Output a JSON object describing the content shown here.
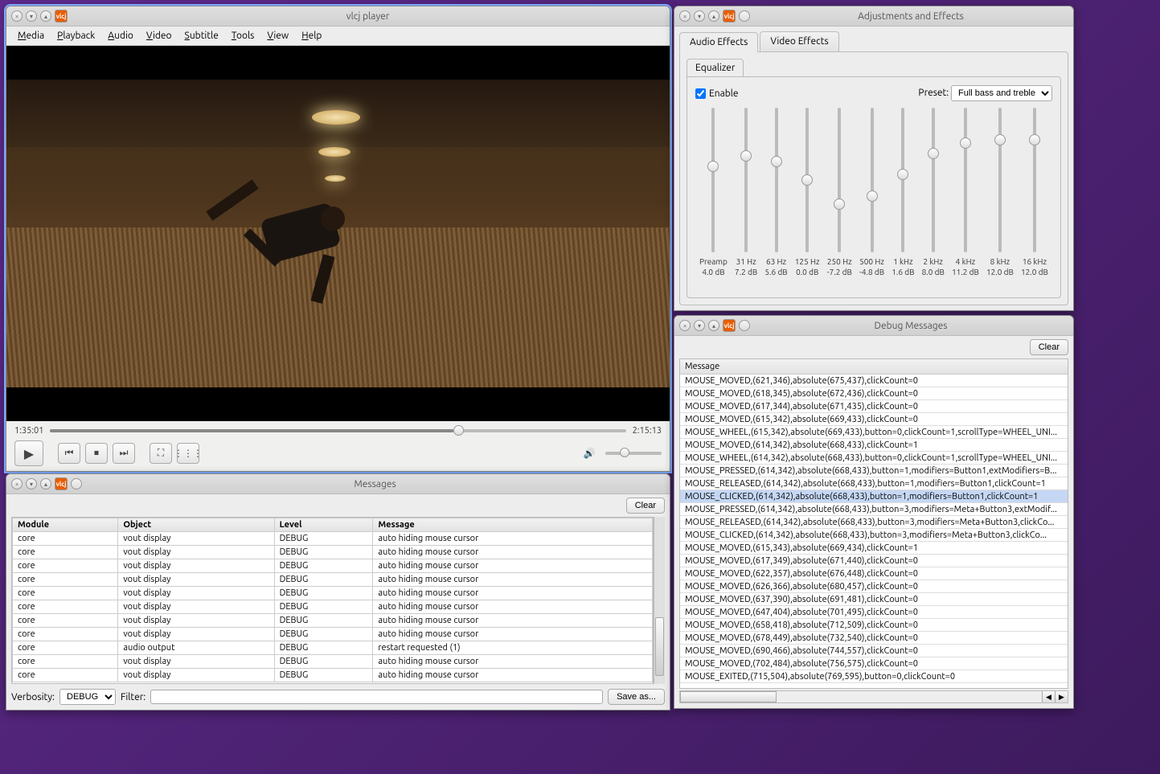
{
  "player": {
    "title": "vlcj player",
    "menu": [
      "Media",
      "Playback",
      "Audio",
      "Video",
      "Subtitle",
      "Tools",
      "View",
      "Help"
    ],
    "time_current": "1:35:01",
    "time_total": "2:15:13",
    "progress_pct": 70,
    "volume_pct": 25,
    "buttons": {
      "play": "▶",
      "prev": "⏮",
      "stop": "⏹",
      "next": "⏭",
      "fullscreen": "⛶",
      "ext": "⋮⋮⋮",
      "speaker": "🔊"
    }
  },
  "messages": {
    "title": "Messages",
    "clear_btn": "Clear",
    "cols": [
      "Module",
      "Object",
      "Level",
      "Message"
    ],
    "rows": [
      [
        "core",
        "vout display",
        "DEBUG",
        "auto hiding mouse cursor"
      ],
      [
        "core",
        "vout display",
        "DEBUG",
        "auto hiding mouse cursor"
      ],
      [
        "core",
        "vout display",
        "DEBUG",
        "auto hiding mouse cursor"
      ],
      [
        "core",
        "vout display",
        "DEBUG",
        "auto hiding mouse cursor"
      ],
      [
        "core",
        "vout display",
        "DEBUG",
        "auto hiding mouse cursor"
      ],
      [
        "core",
        "vout display",
        "DEBUG",
        "auto hiding mouse cursor"
      ],
      [
        "core",
        "vout display",
        "DEBUG",
        "auto hiding mouse cursor"
      ],
      [
        "core",
        "vout display",
        "DEBUG",
        "auto hiding mouse cursor"
      ],
      [
        "core",
        "audio output",
        "DEBUG",
        "restart requested (1)"
      ],
      [
        "core",
        "vout display",
        "DEBUG",
        "auto hiding mouse cursor"
      ],
      [
        "core",
        "vout display",
        "DEBUG",
        "auto hiding mouse cursor"
      ]
    ],
    "verbosity_label": "Verbosity:",
    "verbosity_value": "DEBUG",
    "filter_label": "Filter:",
    "save_btn": "Save as..."
  },
  "adjust": {
    "title": "Adjustments and Effects",
    "tabs": [
      "Audio Effects",
      "Video Effects"
    ],
    "eq_tab": "Equalizer",
    "enable_label": "Enable",
    "preset_label": "Preset:",
    "preset_value": "Full bass and treble",
    "bands": [
      {
        "label": "Preamp",
        "db": "4.0 dB",
        "pct": 60
      },
      {
        "label": "31 Hz",
        "db": "7.2 dB",
        "pct": 68
      },
      {
        "label": "63 Hz",
        "db": "5.6 dB",
        "pct": 64
      },
      {
        "label": "125 Hz",
        "db": "0.0 dB",
        "pct": 50
      },
      {
        "label": "250 Hz",
        "db": "-7.2 dB",
        "pct": 32
      },
      {
        "label": "500 Hz",
        "db": "-4.8 dB",
        "pct": 38
      },
      {
        "label": "1 kHz",
        "db": "1.6 dB",
        "pct": 54
      },
      {
        "label": "2 kHz",
        "db": "8.0 dB",
        "pct": 70
      },
      {
        "label": "4 kHz",
        "db": "11.2 dB",
        "pct": 78
      },
      {
        "label": "8 kHz",
        "db": "12.0 dB",
        "pct": 80
      },
      {
        "label": "16 kHz",
        "db": "12.0 dB",
        "pct": 80
      }
    ]
  },
  "debug": {
    "title": "Debug Messages",
    "clear_btn": "Clear",
    "header": "Message",
    "selected_index": 9,
    "items": [
      "MOUSE_MOVED,(621,346),absolute(675,437),clickCount=0",
      "MOUSE_MOVED,(618,345),absolute(672,436),clickCount=0",
      "MOUSE_MOVED,(617,344),absolute(671,435),clickCount=0",
      "MOUSE_MOVED,(615,342),absolute(669,433),clickCount=0",
      "MOUSE_WHEEL,(615,342),absolute(669,433),button=0,clickCount=1,scrollType=WHEEL_UNI...",
      "MOUSE_MOVED,(614,342),absolute(668,433),clickCount=1",
      "MOUSE_WHEEL,(614,342),absolute(668,433),button=0,clickCount=1,scrollType=WHEEL_UNI...",
      "MOUSE_PRESSED,(614,342),absolute(668,433),button=1,modifiers=Button1,extModifiers=B...",
      "MOUSE_RELEASED,(614,342),absolute(668,433),button=1,modifiers=Button1,clickCount=1",
      "MOUSE_CLICKED,(614,342),absolute(668,433),button=1,modifiers=Button1,clickCount=1",
      "MOUSE_PRESSED,(614,342),absolute(668,433),button=3,modifiers=Meta+Button3,extModif...",
      "MOUSE_RELEASED,(614,342),absolute(668,433),button=3,modifiers=Meta+Button3,clickCo...",
      "MOUSE_CLICKED,(614,342),absolute(668,433),button=3,modifiers=Meta+Button3,clickCo...",
      "MOUSE_MOVED,(615,343),absolute(669,434),clickCount=1",
      "MOUSE_MOVED,(617,349),absolute(671,440),clickCount=0",
      "MOUSE_MOVED,(622,357),absolute(676,448),clickCount=0",
      "MOUSE_MOVED,(626,366),absolute(680,457),clickCount=0",
      "MOUSE_MOVED,(637,390),absolute(691,481),clickCount=0",
      "MOUSE_MOVED,(647,404),absolute(701,495),clickCount=0",
      "MOUSE_MOVED,(658,418),absolute(712,509),clickCount=0",
      "MOUSE_MOVED,(678,449),absolute(732,540),clickCount=0",
      "MOUSE_MOVED,(690,466),absolute(744,557),clickCount=0",
      "MOUSE_MOVED,(702,484),absolute(756,575),clickCount=0",
      "MOUSE_EXITED,(715,504),absolute(769,595),button=0,clickCount=0"
    ]
  }
}
